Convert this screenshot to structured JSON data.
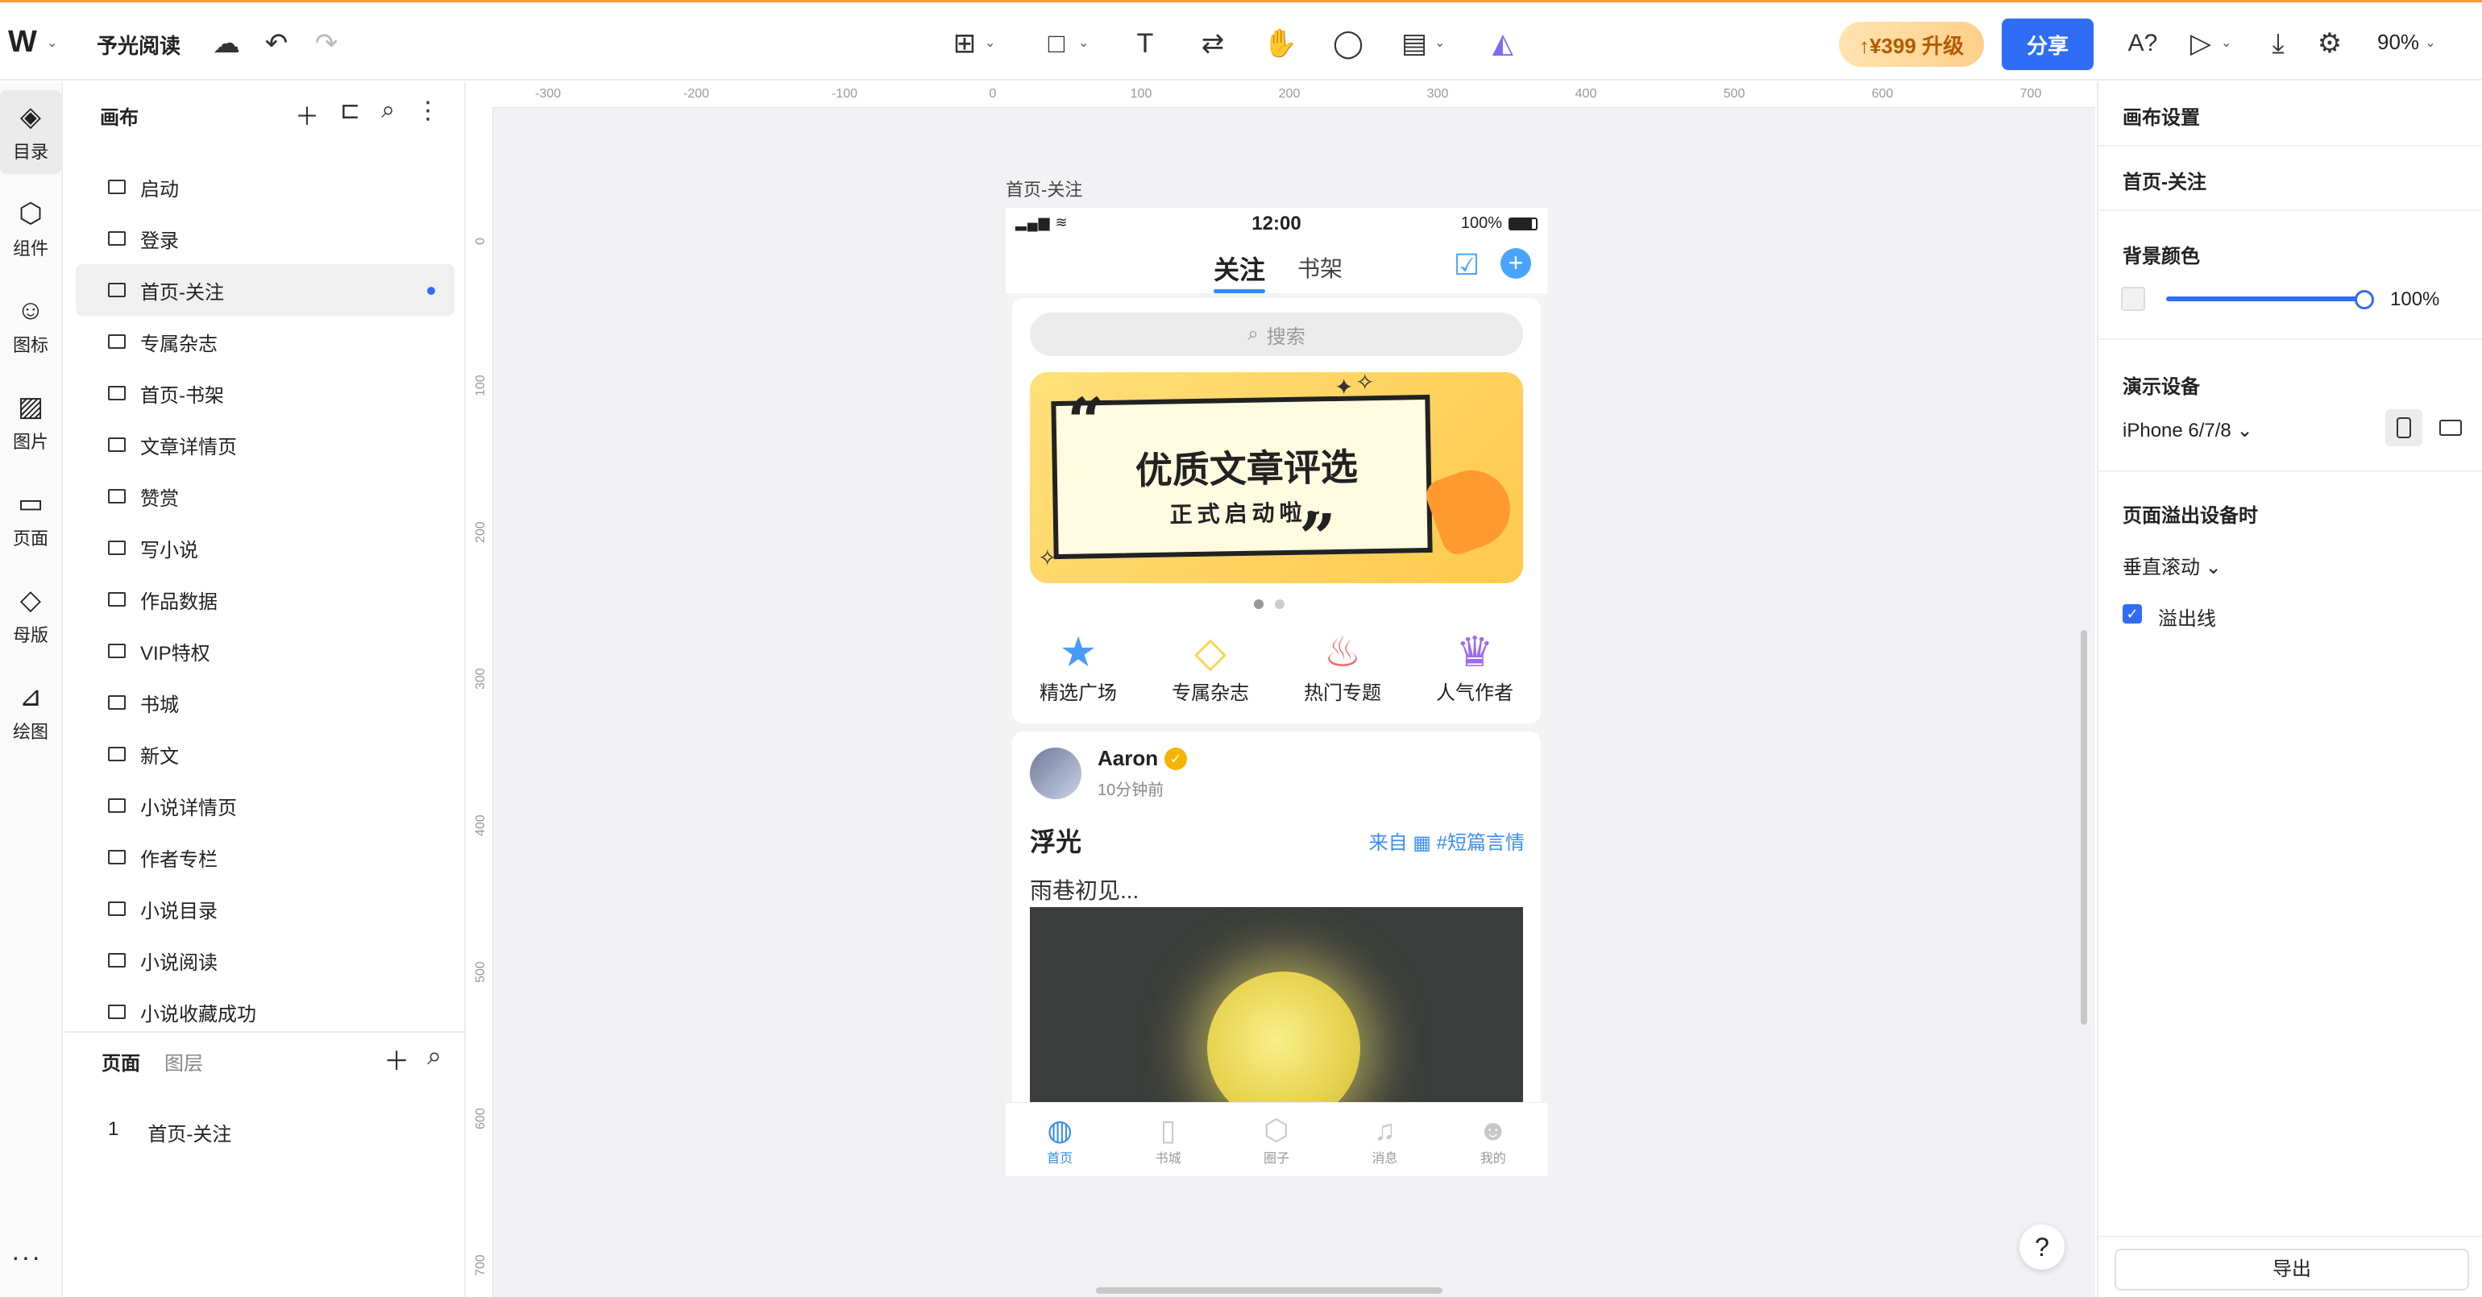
{
  "app": {
    "logo": "W",
    "project_title": "予光阅读",
    "upgrade_label": "↑¥399 升级",
    "share_label": "分享",
    "zoom": "90%"
  },
  "rail": {
    "items": [
      {
        "label": "目录",
        "icon": "layers-icon"
      },
      {
        "label": "组件",
        "icon": "component-icon"
      },
      {
        "label": "图标",
        "icon": "smiley-icon"
      },
      {
        "label": "图片",
        "icon": "image-icon"
      },
      {
        "label": "页面",
        "icon": "page-icon"
      },
      {
        "label": "母版",
        "icon": "master-icon"
      },
      {
        "label": "绘图",
        "icon": "diagram-icon"
      }
    ],
    "more": "···"
  },
  "left_panel": {
    "title": "画布",
    "pages": [
      "启动",
      "登录",
      "首页-关注",
      "专属杂志",
      "首页-书架",
      "文章详情页",
      "赞赏",
      "写小说",
      "作品数据",
      "VIP特权",
      "书城",
      "新文",
      "小说详情页",
      "作者专栏",
      "小说目录",
      "小说阅读",
      "小说收藏成功"
    ],
    "active_page": "首页-关注",
    "bottom_tabs": {
      "pages": "页面",
      "layers": "图层"
    },
    "layer_row": {
      "index": "1",
      "name": "首页-关注"
    }
  },
  "canvas": {
    "ruler_h": [
      "-300",
      "-200",
      "-100",
      "0",
      "100",
      "200",
      "300",
      "400",
      "500",
      "600",
      "700"
    ],
    "ruler_v": [
      "0",
      "100",
      "200",
      "300",
      "400",
      "500",
      "600",
      "700"
    ],
    "frame_label": "首页-关注",
    "help": "?"
  },
  "phone": {
    "status": {
      "time": "12:00",
      "battery": "100%"
    },
    "tabs": {
      "follow": "关注",
      "shelf": "书架"
    },
    "search_placeholder": "搜索",
    "banner": {
      "title": "优质文章评选",
      "subtitle": "正式启动啦~"
    },
    "shortcuts": [
      {
        "label": "精选广场",
        "icon": "star-icon"
      },
      {
        "label": "专属杂志",
        "icon": "diamond-icon"
      },
      {
        "label": "热门专题",
        "icon": "flame-icon"
      },
      {
        "label": "人气作者",
        "icon": "crown-icon"
      }
    ],
    "post": {
      "user": "Aaron",
      "time": "10分钟前",
      "title": "浮光",
      "tag": "来自 ▦ #短篇言情",
      "excerpt": "雨巷初见..."
    },
    "tabbar": [
      {
        "label": "首页",
        "active": true
      },
      {
        "label": "书城",
        "active": false
      },
      {
        "label": "圈子",
        "active": false
      },
      {
        "label": "消息",
        "active": false
      },
      {
        "label": "我的",
        "active": false
      }
    ]
  },
  "right_panel": {
    "title": "画布设置",
    "page_name": "首页-关注",
    "bg_label": "背景颜色",
    "bg_opacity": "100%",
    "device_label": "演示设备",
    "device_value": "iPhone 6/7/8 ⌄",
    "overflow_label": "页面溢出设备时",
    "overflow_value": "垂直滚动 ⌄",
    "overflow_line": "溢出线",
    "export": "导出"
  },
  "colors": {
    "accent": "#2f6df6",
    "brand_orange": "#ff9a3c"
  }
}
